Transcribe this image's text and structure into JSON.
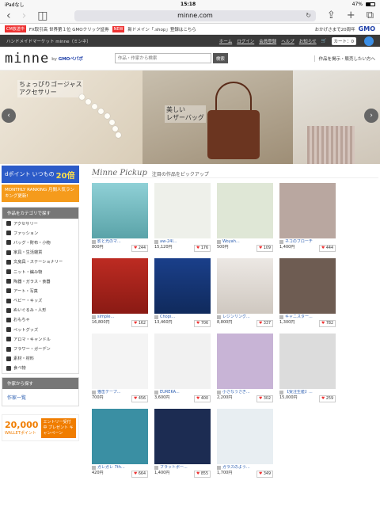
{
  "status": {
    "left": "iPadなし",
    "time": "15:18",
    "battery": "47%"
  },
  "browser": {
    "url": "minne.com"
  },
  "ads": {
    "tag": "CM放送中",
    "text1": "FX取引高 世界第１位 GMOクリック証券",
    "new": "NEW",
    "text2": "新ドメイン「.shop」登録はこちら",
    "right": "おかげさまで20周年",
    "brand": "GMO"
  },
  "topbar": {
    "site": "ハンドメイドマーケット minne（ミンネ）",
    "links": [
      "ホーム",
      "ログイン",
      "会員登録",
      "ヘルプ",
      "お知らせ"
    ],
    "cart": "カート：0"
  },
  "header": {
    "logo": "minne",
    "by": "by",
    "brand": "GMOペパボ",
    "search_placeholder": "作品・作家から検索",
    "search_button": "検索",
    "sell": "作品を掲示・販売したい方へ"
  },
  "hero": {
    "left": "ちょっぴりゴージャス\nアクセサリー",
    "center": "美しい\nレザーバッグ"
  },
  "side": {
    "dpoint": "dポイント いつもの",
    "dpoint_big": "20倍",
    "ranking": "MONTHLY RANKING 月間人気ランキング更新!",
    "cat_title": "作品をカテゴリで探す",
    "cats": [
      "アクセサリー",
      "ファッション",
      "バッグ・財布・小物",
      "家具・生活雑貨",
      "文房具・ステーショナリー",
      "ニット・編み物",
      "陶器・ガラス・食器",
      "アート・写真",
      "ベビー・キッズ",
      "ぬいぐるみ・人形",
      "おもちゃ",
      "ペットグッズ",
      "アロマ・キャンドル",
      "フラワー・ガーデン",
      "素材・材料",
      "食べ物"
    ],
    "creator_title": "作家から探す",
    "creator_link": "作家一覧",
    "wallet": "20,000",
    "wallet_sub": "WALLETポイント",
    "wallet_promo": "エントリー受付中 プレゼント キャンペーン"
  },
  "main": {
    "pick_script": "Minne Pickup",
    "pick_text": "注目の作品をピックアップ"
  },
  "items": [
    {
      "name": "影と光のマ...",
      "price": "800円",
      "likes": "244"
    },
    {
      "name": "aw-24l...",
      "price": "15,120円",
      "likes": "176"
    },
    {
      "name": "Woyah...",
      "price": "500円",
      "likes": "109"
    },
    {
      "name": "ネコのブローチ",
      "price": "1,400円",
      "likes": "444"
    },
    {
      "name": "simple...",
      "price": "16,800円",
      "likes": "162"
    },
    {
      "name": "Chopi...",
      "price": "13,460円",
      "likes": "706"
    },
    {
      "name": "レジンリング...",
      "price": "8,800円",
      "likes": "337"
    },
    {
      "name": "キャニスター...",
      "price": "1,300円",
      "likes": "782"
    },
    {
      "name": "猫缶テープ...",
      "price": "700円",
      "likes": "456"
    },
    {
      "name": "EUREKA...",
      "price": "3,600円",
      "likes": "400"
    },
    {
      "name": "小さなうさぎ...",
      "price": "2,200円",
      "likes": "302"
    },
    {
      "name": "【受注生産】...",
      "price": "15,000円",
      "likes": "259"
    },
    {
      "name": "ガレガレ 7th...",
      "price": "420円",
      "likes": "664"
    },
    {
      "name": "フラットポー...",
      "price": "1,400円",
      "likes": "855"
    },
    {
      "name": "ガラスのよう...",
      "price": "1,700円",
      "likes": "349"
    }
  ],
  "colors": {
    "accent": "#2a5db0",
    "topbar": "#3a3a3a",
    "heart": "#e33"
  }
}
